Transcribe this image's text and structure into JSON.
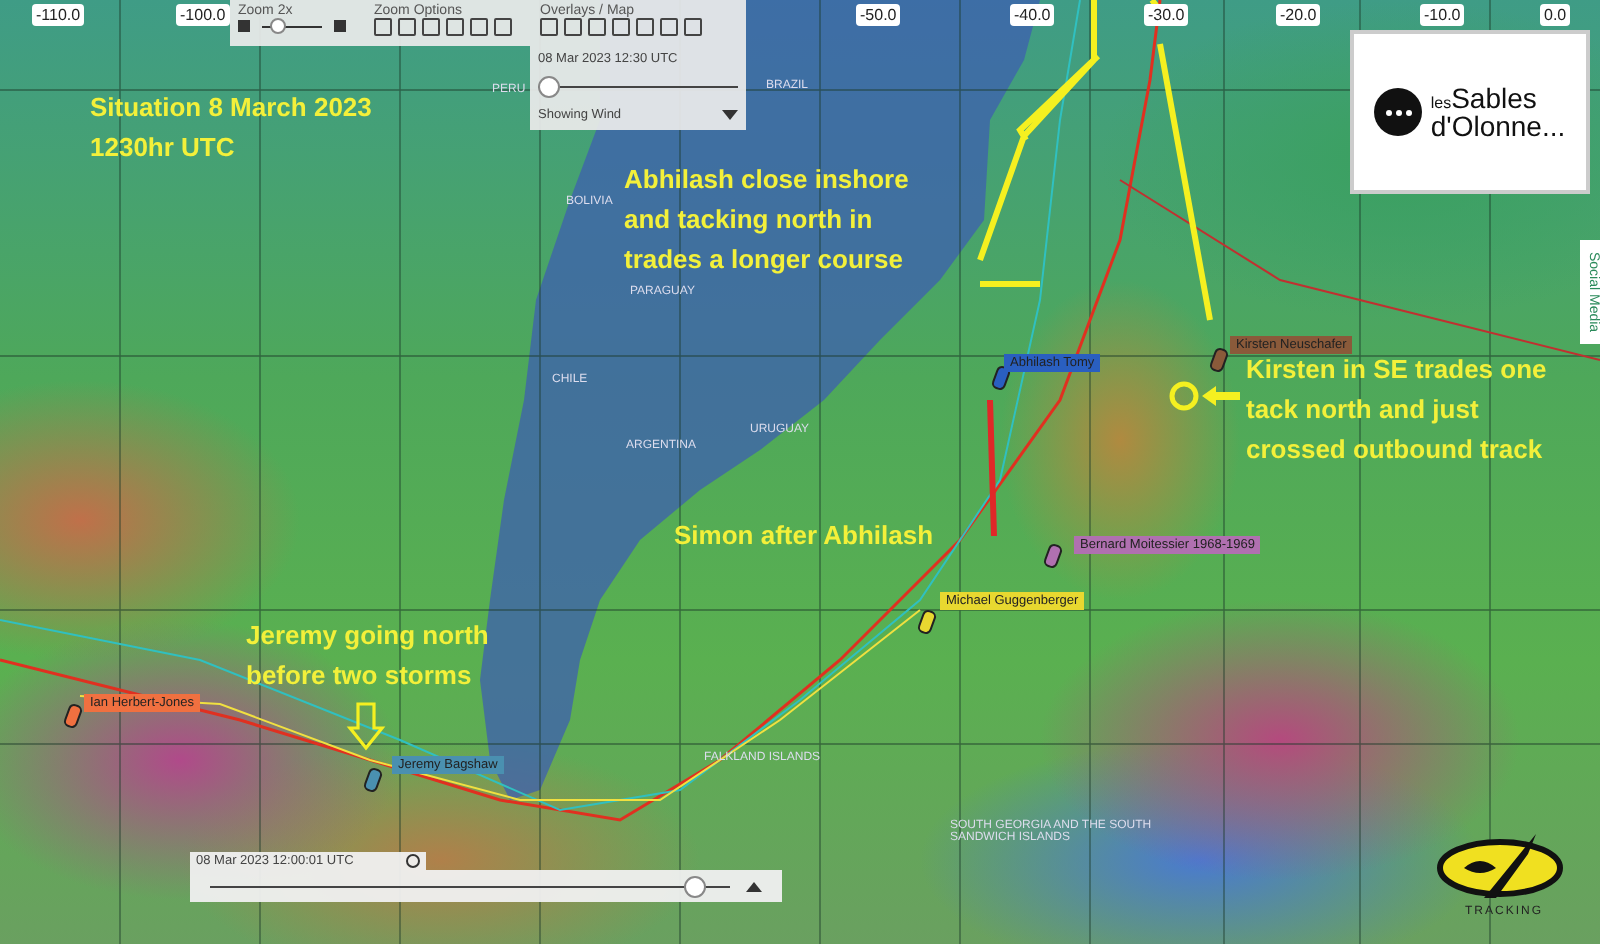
{
  "longitude_labels": [
    "-110.0",
    "-100.0",
    "-50.0",
    "-40.0",
    "-30.0",
    "-20.0",
    "-10.0",
    "0.0"
  ],
  "toolbar": {
    "zoom_label": "Zoom 2x",
    "zoom_slider": {
      "level": 0.2
    },
    "options_label": "Zoom Options",
    "overlays_label": "Overlays / Map"
  },
  "time_panel": {
    "time": "08 Mar 2023 12:30 UTC",
    "level": 0.0,
    "layer": "Showing Wind"
  },
  "countries": [
    "PERU",
    "BRAZIL",
    "BOLIVIA",
    "PARAGUAY",
    "CHILE",
    "ARGENTINA",
    "URUGUAY",
    "FALKLAND ISLANDS",
    "SOUTH GEORGIA AND THE SOUTH\nSANDWICH ISLANDS"
  ],
  "boats": [
    {
      "name": "Abhilash Tomy",
      "color": "#2a5fc0"
    },
    {
      "name": "Kirsten Neuschafer",
      "color": "#8a5a3a"
    },
    {
      "name": "Bernard Moitessier 1968-1969",
      "color": "#b070b0"
    },
    {
      "name": "Michael Guggenberger",
      "color": "#e8d830"
    },
    {
      "name": "Ian Herbert-Jones",
      "color": "#f07040"
    },
    {
      "name": "Jeremy Bagshaw",
      "color": "#4a90b0"
    }
  ],
  "annotations": [
    "Situation 8 March 2023\n1230hr UTC",
    "Abhilash close inshore\nand tacking north in\ntrades a longer course",
    "Kirsten in SE trades one\ntack north and just\ncrossed outbound track",
    "Simon after Abhilash",
    "Jeremy going north\nbefore two storms"
  ],
  "logo": {
    "small": "les",
    "large": "Sables",
    "second_line": "d'Olonne..."
  },
  "playback": {
    "time": "08 Mar 2023 12:00:01 UTC",
    "level": 0.95
  },
  "side_tab": "Social Media",
  "tracking_logo": "TRACKING"
}
